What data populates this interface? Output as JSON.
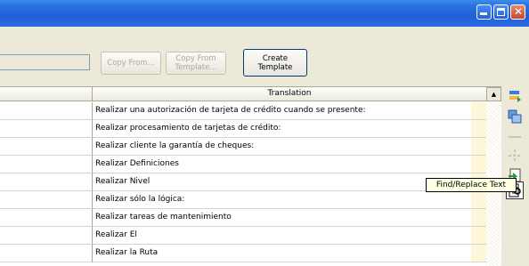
{
  "toolbar": {
    "copy_from": "Copy From...",
    "copy_from_template_line1": "Copy From",
    "copy_from_template_line2": "Template...",
    "create_template_line1": "Create",
    "create_template_line2": "Template"
  },
  "grid": {
    "header": "Translation",
    "rows": [
      "Realizar una autorización de tarjeta de crédito cuando se presente:",
      "Realizar procesamiento de tarjetas de crédito:",
      "Realizar cliente la garantía de cheques:",
      "Realizar Definiciones",
      "Realizar Nivel",
      "Realizar sólo la lógica:",
      "Realizar tareas de mantenimiento",
      "Realizar El",
      "Realizar la Ruta"
    ]
  },
  "tooltip": "Find/Replace Text",
  "colors": {
    "title_bar": "#2a74e0",
    "close_button": "#d45a3a",
    "tooltip_bg": "#ffffe1",
    "highlight_column": "#fdf6d8"
  },
  "icons": [
    "window-minimize-icon",
    "window-maximize-icon",
    "window-close-icon",
    "scroll-up-icon",
    "sidebar-icon-1",
    "sidebar-icon-2",
    "sidebar-icon-3",
    "sidebar-icon-4",
    "sidebar-icon-5",
    "find-replace-icon"
  ]
}
